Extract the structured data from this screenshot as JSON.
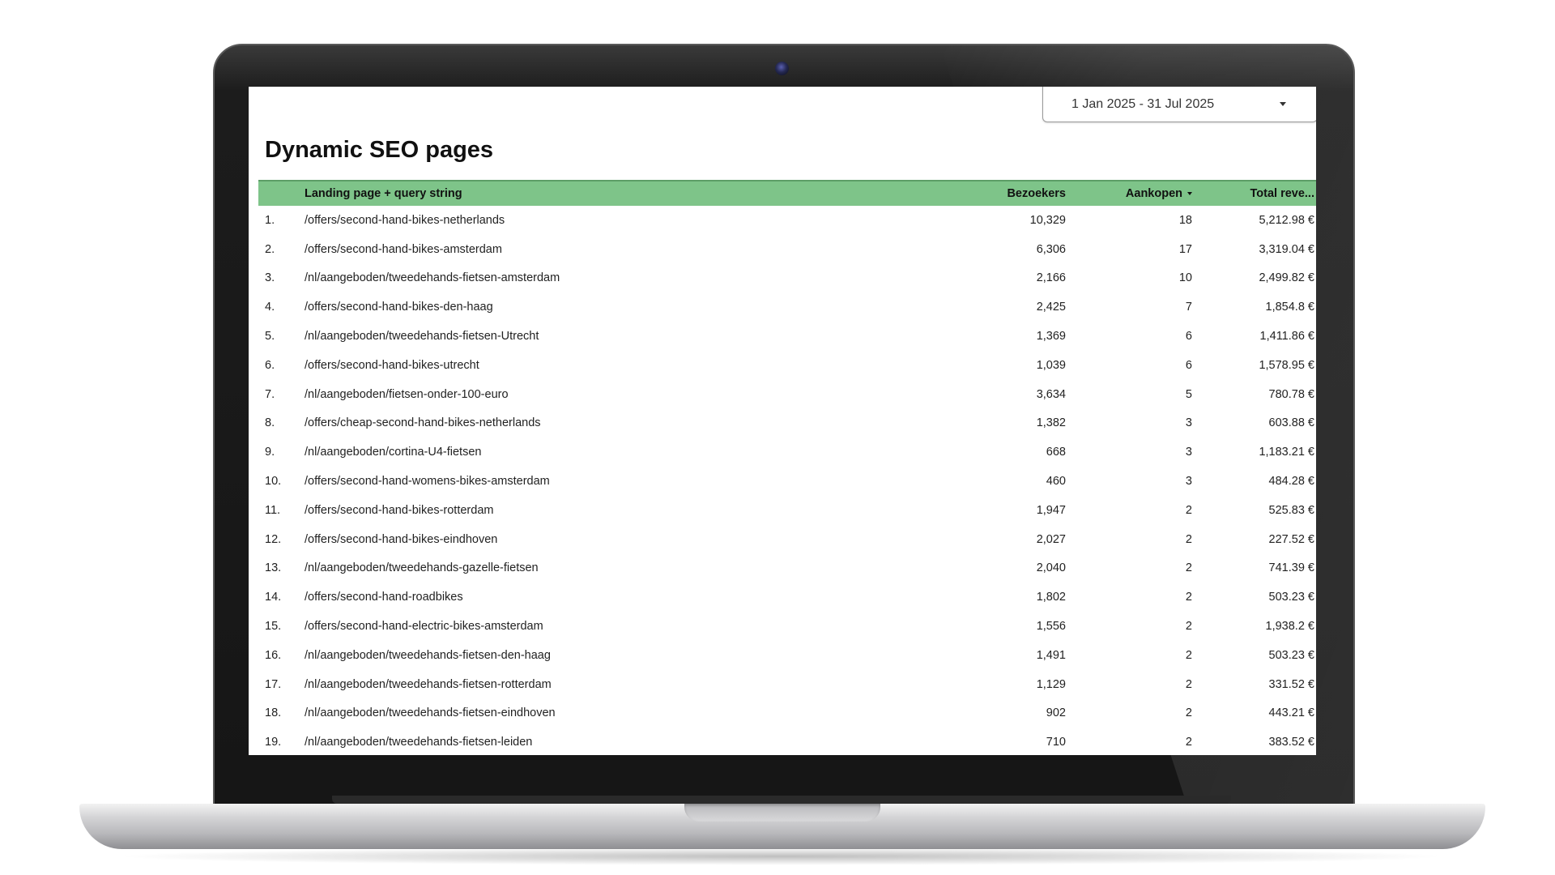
{
  "date_range": {
    "label": "1 Jan 2025 - 31 Jul 2025"
  },
  "report": {
    "title": "Dynamic SEO pages",
    "columns": {
      "page": "Landing page + query string",
      "visitors": "Bezoekers",
      "purchases": "Aankopen",
      "revenue": "Total reve..."
    },
    "rows": [
      {
        "num": "1.",
        "page": "/offers/second-hand-bikes-netherlands",
        "visitors": "10,329",
        "purchases": "18",
        "revenue": "5,212.98 €"
      },
      {
        "num": "2.",
        "page": "/offers/second-hand-bikes-amsterdam",
        "visitors": "6,306",
        "purchases": "17",
        "revenue": "3,319.04 €"
      },
      {
        "num": "3.",
        "page": "/nl/aangeboden/tweedehands-fietsen-amsterdam",
        "visitors": "2,166",
        "purchases": "10",
        "revenue": "2,499.82 €"
      },
      {
        "num": "4.",
        "page": "/offers/second-hand-bikes-den-haag",
        "visitors": "2,425",
        "purchases": "7",
        "revenue": "1,854.8 €"
      },
      {
        "num": "5.",
        "page": "/nl/aangeboden/tweedehands-fietsen-Utrecht",
        "visitors": "1,369",
        "purchases": "6",
        "revenue": "1,411.86 €"
      },
      {
        "num": "6.",
        "page": "/offers/second-hand-bikes-utrecht",
        "visitors": "1,039",
        "purchases": "6",
        "revenue": "1,578.95 €"
      },
      {
        "num": "7.",
        "page": "/nl/aangeboden/fietsen-onder-100-euro",
        "visitors": "3,634",
        "purchases": "5",
        "revenue": "780.78 €"
      },
      {
        "num": "8.",
        "page": "/offers/cheap-second-hand-bikes-netherlands",
        "visitors": "1,382",
        "purchases": "3",
        "revenue": "603.88 €"
      },
      {
        "num": "9.",
        "page": "/nl/aangeboden/cortina-U4-fietsen",
        "visitors": "668",
        "purchases": "3",
        "revenue": "1,183.21 €"
      },
      {
        "num": "10.",
        "page": "/offers/second-hand-womens-bikes-amsterdam",
        "visitors": "460",
        "purchases": "3",
        "revenue": "484.28 €"
      },
      {
        "num": "11.",
        "page": "/offers/second-hand-bikes-rotterdam",
        "visitors": "1,947",
        "purchases": "2",
        "revenue": "525.83 €"
      },
      {
        "num": "12.",
        "page": "/offers/second-hand-bikes-eindhoven",
        "visitors": "2,027",
        "purchases": "2",
        "revenue": "227.52 €"
      },
      {
        "num": "13.",
        "page": "/nl/aangeboden/tweedehands-gazelle-fietsen",
        "visitors": "2,040",
        "purchases": "2",
        "revenue": "741.39 €"
      },
      {
        "num": "14.",
        "page": "/offers/second-hand-roadbikes",
        "visitors": "1,802",
        "purchases": "2",
        "revenue": "503.23 €"
      },
      {
        "num": "15.",
        "page": "/offers/second-hand-electric-bikes-amsterdam",
        "visitors": "1,556",
        "purchases": "2",
        "revenue": "1,938.2 €"
      },
      {
        "num": "16.",
        "page": "/nl/aangeboden/tweedehands-fietsen-den-haag",
        "visitors": "1,491",
        "purchases": "2",
        "revenue": "503.23 €"
      },
      {
        "num": "17.",
        "page": "/nl/aangeboden/tweedehands-fietsen-rotterdam",
        "visitors": "1,129",
        "purchases": "2",
        "revenue": "331.52 €"
      },
      {
        "num": "18.",
        "page": "/nl/aangeboden/tweedehands-fietsen-eindhoven",
        "visitors": "902",
        "purchases": "2",
        "revenue": "443.21 €"
      },
      {
        "num": "19.",
        "page": "/nl/aangeboden/tweedehands-fietsen-leiden",
        "visitors": "710",
        "purchases": "2",
        "revenue": "383.52 €"
      }
    ]
  },
  "colors": {
    "header_green": "#7ec489",
    "laptop_bezel": "#161616",
    "camera_lens": "#3d3f8a"
  },
  "icons": {
    "date_dropdown": "caret-down-icon",
    "sort": "sort-desc-icon",
    "camera": "camera-icon"
  }
}
